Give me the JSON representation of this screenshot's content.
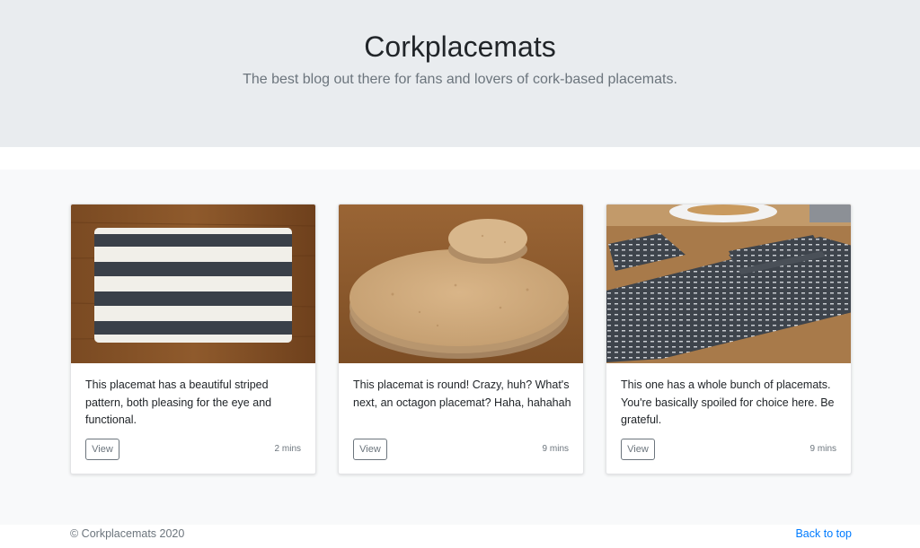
{
  "header": {
    "title": "Corkplacemats",
    "subtitle": "The best blog out there for fans and lovers of cork-based placemats."
  },
  "cards": [
    {
      "image": "striped-placemat-image",
      "text": "This placemat has a beautiful striped pattern, both pleasing for the eye and functional.",
      "button": "View",
      "time": "2 mins"
    },
    {
      "image": "round-cork-placemat-image",
      "text": "This placemat is round! Crazy, huh? What's next, an octagon placemat? Haha, hahahah",
      "button": "View",
      "time": "9 mins"
    },
    {
      "image": "patterned-placemats-set-image",
      "text": "This one has a whole bunch of placemats. You're basically spoiled for choice here. Be grateful.",
      "button": "View",
      "time": "9 mins"
    }
  ],
  "footer": {
    "copyright": "© Corkplacemats 2020",
    "back_to_top": "Back to top"
  },
  "colors": {
    "header_bg": "#e9ecef",
    "album_bg": "#f8f9fa",
    "link": "#007bff",
    "muted": "#6c757d"
  }
}
